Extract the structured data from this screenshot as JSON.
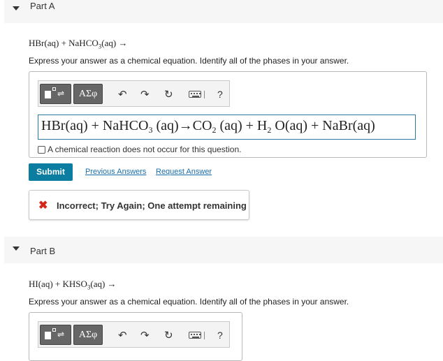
{
  "partA": {
    "title": "Part A",
    "question_lhs": "HBr(aq) + NaHCO",
    "question_sub": "3",
    "question_rhs": "(aq) →",
    "instructions": "Express your answer as a chemical equation. Identify all of the phases in your answer.",
    "toolbar": {
      "greek_label": "ΑΣφ",
      "undo_icon": "↶",
      "redo_icon": "↷",
      "reset_icon": "↻",
      "help_label": "?"
    },
    "answer": {
      "t1": "HBr(aq) + NaHCO",
      "s1": "3",
      "t2": " (aq)→CO",
      "s2": "2",
      "t3": " (aq) + H",
      "s3": "2",
      "t4": " O(aq) + NaBr(aq)"
    },
    "no_reaction_label": "A chemical reaction does not occur for this question.",
    "submit_label": "Submit",
    "previous_answers_label": "Previous Answers",
    "request_answer_label": "Request Answer",
    "feedback_icon": "✖",
    "feedback_text": "Incorrect; Try Again; One attempt remaining"
  },
  "partB": {
    "title": "Part B",
    "question_lhs": "HI(aq) + KHSO",
    "question_sub": "3",
    "question_rhs": "(aq) →",
    "instructions": "Express your answer as a chemical equation. Identify all of the phases in your answer.",
    "toolbar": {
      "greek_label": "ΑΣφ",
      "undo_icon": "↶",
      "redo_icon": "↷",
      "reset_icon": "↻",
      "help_label": "?"
    }
  },
  "colors": {
    "submit_bg": "#0a7da0",
    "link": "#1a6ea8",
    "error_icon": "#d4261c",
    "answer_border": "#2a7aa0"
  }
}
